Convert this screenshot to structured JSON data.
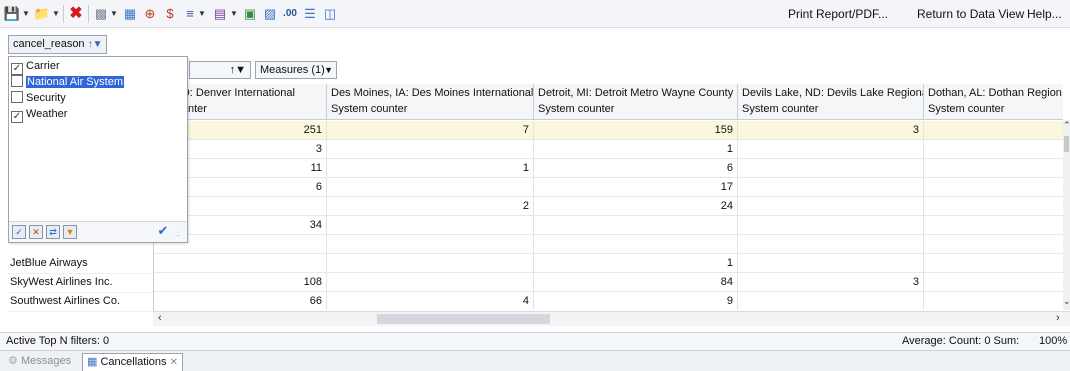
{
  "toolbar": {
    "icons": [
      "save-icon",
      "open-icon",
      "delete-icon",
      "insert-icon",
      "calc-icon",
      "ratio-icon",
      "currency-icon",
      "format-icon",
      "chart-icon",
      "export-icon",
      "pivot-icon",
      "decimal-icon",
      "list-icon",
      "report-icon"
    ],
    "print_label": "Print Report/PDF...",
    "return_label": "Return to Data View",
    "help_label": "Help..."
  },
  "filter": {
    "field": "cancel_reason"
  },
  "popup": {
    "items": [
      {
        "label": "Carrier",
        "checked": true
      },
      {
        "label": "National Air System",
        "checked": false,
        "selected": true
      },
      {
        "label": "Security",
        "checked": false
      },
      {
        "label": "Weather",
        "checked": true
      }
    ]
  },
  "measures": {
    "label": "Measures (1)"
  },
  "row_headers": [
    "JetBlue Airways",
    "SkyWest Airlines Inc.",
    "Southwest Airlines Co."
  ],
  "columns": [
    {
      "title": "er, CO: Denver International",
      "sub": "m counter"
    },
    {
      "title": "Des Moines, IA: Des Moines International",
      "sub": "System counter"
    },
    {
      "title": "Detroit, MI: Detroit Metro Wayne County",
      "sub": "System counter"
    },
    {
      "title": "Devils Lake, ND: Devils Lake Regional",
      "sub": "System counter"
    },
    {
      "title": "Dothan, AL: Dothan Region",
      "sub": "System counter"
    }
  ],
  "rows": [
    [
      "251",
      "7",
      "159",
      "3",
      ""
    ],
    [
      "3",
      "",
      "1",
      "",
      ""
    ],
    [
      "11",
      "1",
      "6",
      "",
      ""
    ],
    [
      "6",
      "",
      "17",
      "",
      ""
    ],
    [
      "",
      "2",
      "24",
      "",
      ""
    ],
    [
      "34",
      "",
      "",
      "",
      ""
    ],
    [
      "",
      "",
      "",
      "",
      ""
    ],
    [
      "",
      "",
      "1",
      "",
      ""
    ],
    [
      "108",
      "",
      "84",
      "3",
      ""
    ],
    [
      "66",
      "4",
      "9",
      "",
      ""
    ]
  ],
  "status": {
    "left": "Active Top N filters: 0",
    "right": "Average:  Count: 0  Sum:",
    "zoom": "100%"
  },
  "tabs": [
    {
      "label": "Messages",
      "active": false
    },
    {
      "label": "Cancellations",
      "active": true
    }
  ],
  "colors": {
    "highlight_row": "#fbf7dc",
    "selection": "#2f67d6"
  }
}
